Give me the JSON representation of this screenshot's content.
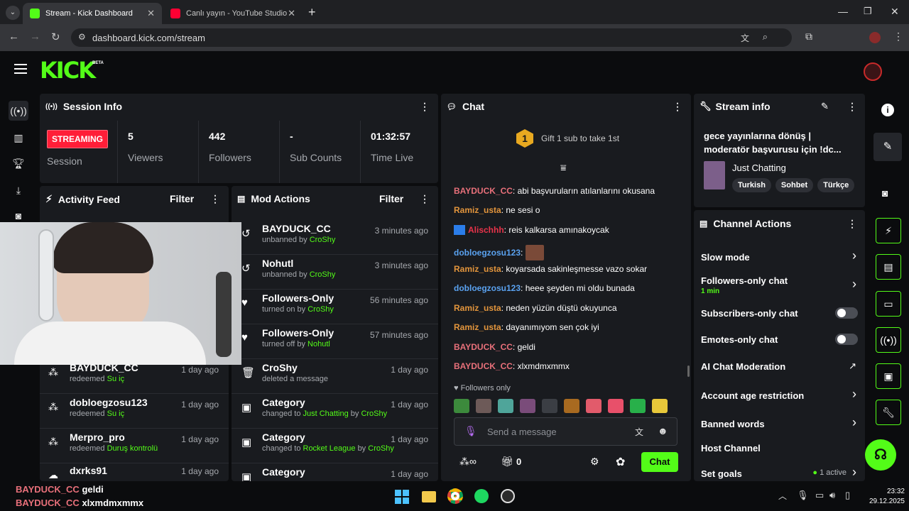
{
  "browser": {
    "tabs": [
      {
        "title": "Stream - Kick Dashboard",
        "favicon_color": "#53fc18"
      },
      {
        "title": "Canlı yayın - YouTube Studio",
        "favicon_color": "#ff0033"
      }
    ],
    "url": "dashboard.kick.com/stream"
  },
  "header": {
    "logo": "KICK",
    "badge": "BETA"
  },
  "session": {
    "title": "Session Info",
    "status_badge": "STREAMING",
    "session_label": "Session",
    "stats": [
      {
        "value": "5",
        "label": "Viewers"
      },
      {
        "value": "442",
        "label": "Followers"
      },
      {
        "value": "-",
        "label": "Sub Counts"
      },
      {
        "value": "01:32:57",
        "label": "Time Live"
      }
    ]
  },
  "activity": {
    "title": "Activity Feed",
    "filter": "Filter",
    "items": [
      {
        "user": "BAYDUCK_CC",
        "action": "redeemed",
        "reward": "Su iç",
        "time": "1 day ago"
      },
      {
        "user": "dobloegzosu123",
        "action": "redeemed",
        "reward": "Su iç",
        "time": "1 day ago"
      },
      {
        "user": "Merpro_pro",
        "action": "redeemed",
        "reward": "Duruş kontrolü",
        "time": "1 day ago"
      },
      {
        "user": "dxrks91",
        "action": "",
        "reward": "",
        "time": "1 day ago"
      }
    ]
  },
  "mod": {
    "title": "Mod Actions",
    "filter": "Filter",
    "items": [
      {
        "title": "BAYDUCK_CC",
        "prefix": "unbanned by",
        "target": "CroShy",
        "suffix": "",
        "suffix_user": "",
        "time": "3 minutes ago",
        "icon": "undo-icon"
      },
      {
        "title": "Nohutl",
        "prefix": "unbanned by",
        "target": "CroShy",
        "suffix": "",
        "suffix_user": "",
        "time": "3 minutes ago",
        "icon": "undo-icon"
      },
      {
        "title": "Followers-Only",
        "prefix": "turned on by",
        "target": "CroShy",
        "suffix": "",
        "suffix_user": "",
        "time": "56 minutes ago",
        "icon": "heart-icon"
      },
      {
        "title": "Followers-Only",
        "prefix": "turned off by",
        "target": "Nohutl",
        "suffix": "",
        "suffix_user": "",
        "time": "57 minutes ago",
        "icon": "heart-icon"
      },
      {
        "title": "CroShy",
        "prefix": "deleted a message",
        "target": "",
        "suffix": "",
        "suffix_user": "",
        "time": "1 day ago",
        "icon": "trash-icon"
      },
      {
        "title": "Category",
        "prefix": "changed to",
        "target": "Just Chatting",
        "suffix": "by",
        "suffix_user": "CroShy",
        "time": "1 day ago",
        "icon": "category-icon"
      },
      {
        "title": "Category",
        "prefix": "changed to",
        "target": "Rocket League",
        "suffix": "by",
        "suffix_user": "CroShy",
        "time": "1 day ago",
        "icon": "category-icon"
      },
      {
        "title": "Category",
        "prefix": "",
        "target": "",
        "suffix": "",
        "suffix_user": "",
        "time": "1 day ago",
        "icon": "category-icon"
      }
    ]
  },
  "chat": {
    "title": "Chat",
    "gift_banner": "Gift 1 sub to take 1st",
    "gift_rank": "1",
    "messages": [
      {
        "user": "BAYDUCK_CC",
        "text": "abi başvuruların atılanlarını okusana",
        "color": "red"
      },
      {
        "user": "Ramiz_usta",
        "text": "ne sesi o",
        "color": "or"
      },
      {
        "user": "Alischhh",
        "text": "reis kalkarsa amınakoycak",
        "color": "crim"
      },
      {
        "user": "dobloegzosu123",
        "text": "",
        "color": "bl"
      },
      {
        "user": "Ramiz_usta",
        "text": "koyarsada sakinleşmesse vazo sokar",
        "color": "or"
      },
      {
        "user": "dobloegzosu123",
        "text": "heee şeyden mi oldu bunada",
        "color": "bl"
      },
      {
        "user": "Ramiz_usta",
        "text": "neden yüzün düştü okuyunca",
        "color": "or"
      },
      {
        "user": "Ramiz_usta",
        "text": "dayanımıyom sen çok iyi",
        "color": "or"
      },
      {
        "user": "BAYDUCK_CC",
        "text": "geldi",
        "color": "red"
      },
      {
        "user": "BAYDUCK_CC",
        "text": "xlxmdmxmmx",
        "color": "red"
      }
    ],
    "followers_only": "Followers only",
    "placeholder": "Send a message",
    "points": "0",
    "send": "Chat"
  },
  "stream_info": {
    "title": "Stream info",
    "stream_title": "gece yayınlarına dönüş | moderatör başvurusu için !dc...",
    "category": "Just Chatting",
    "tags": [
      "Turkish",
      "Sohbet",
      "Türkçe"
    ]
  },
  "channel_actions": {
    "title": "Channel Actions",
    "slow_mode": "Slow mode",
    "followers_only": "Followers-only chat",
    "followers_only_value": "1 min",
    "subs_only": "Subscribers-only chat",
    "emotes_only": "Emotes-only chat",
    "ai_mod": "AI Chat Moderation",
    "age_restrict": "Account age restriction",
    "banned_words": "Banned words",
    "host": "Host Channel",
    "goals": "Set goals",
    "goals_status": "1 active"
  },
  "overlay_chat": [
    {
      "user": "BAYDUCK_CC",
      "text": "geldi"
    },
    {
      "user": "BAYDUCK_CC",
      "text": "xlxmdmxmmx"
    }
  ],
  "taskbar": {
    "time": "23:32",
    "date": "29.12.2025"
  },
  "colors": {
    "accent": "#53fc18",
    "live": "#ff1e38",
    "panel": "#191b1f"
  }
}
